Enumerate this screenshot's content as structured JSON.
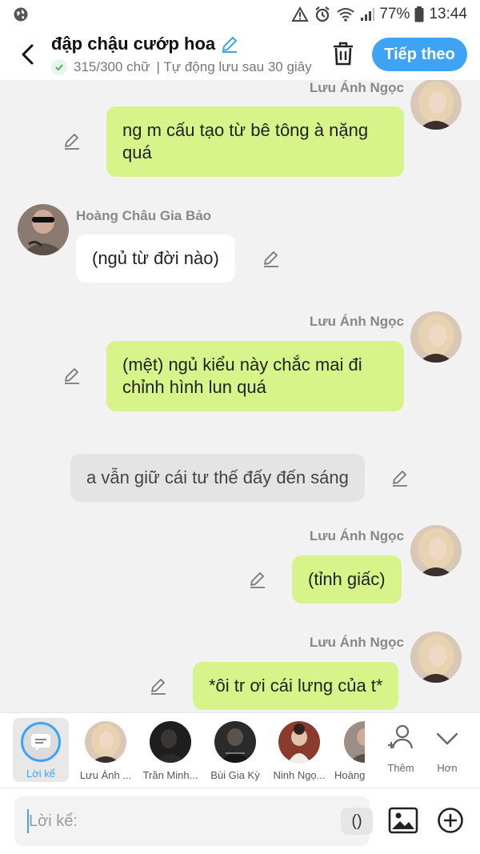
{
  "status_bar": {
    "battery": "77%",
    "time": "13:44"
  },
  "header": {
    "title": "đập chậu cướp hoa",
    "char_count": "315/300 chữ",
    "autosave": "| Tự động lưu sau 30 giây",
    "next_button": "Tiếp theo"
  },
  "messages": [
    {
      "type": "right",
      "sender": "Lưu Ánh Ngọc",
      "text": "ng m cấu tạo từ bê tông à nặng quá",
      "avatar": "avatar-luu-anh-ngoc"
    },
    {
      "type": "left",
      "sender": "Hoàng Châu Gia Bảo",
      "text": "(ngủ từ đời nào)",
      "avatar": "avatar-hoang-chau-gia-bao"
    },
    {
      "type": "right",
      "sender": "Lưu Ánh Ngọc",
      "text": "(mệt) ngủ kiểu này chắc mai đi chỉnh hình lun quá",
      "avatar": "avatar-luu-anh-ngoc"
    },
    {
      "type": "narration",
      "text": "a vẫn giữ cái tư thế đấy đến sáng"
    },
    {
      "type": "right",
      "sender": "Lưu Ánh Ngọc",
      "text": "(tỉnh giấc)",
      "avatar": "avatar-luu-anh-ngoc"
    },
    {
      "type": "right",
      "sender": "Lưu Ánh Ngọc",
      "text": "*ôi tr ơi cái lưng của t*",
      "avatar": "avatar-luu-anh-ngoc"
    }
  ],
  "characters": {
    "narrator_label": "Lời kể",
    "items": [
      {
        "label": "Lưu Ánh ..."
      },
      {
        "label": "Trần Minh..."
      },
      {
        "label": "Bùi Gia Kỳ"
      },
      {
        "label": "Ninh Ngọ..."
      },
      {
        "label": "Hoàng"
      }
    ],
    "add_label": "Thêm",
    "more_label": "Hơn"
  },
  "input": {
    "placeholder": "Lời kể:",
    "paren_label": "()"
  },
  "colors": {
    "accent": "#3ea3f5",
    "bubble_green": "#d6f48a",
    "background": "#f2f2f2"
  }
}
